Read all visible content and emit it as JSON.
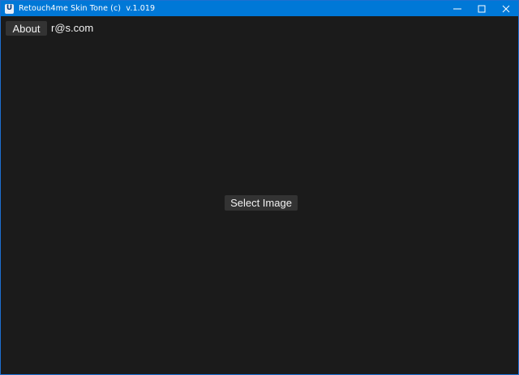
{
  "window": {
    "title": "Retouch4me Skin Tone (c)  v.1.019",
    "icon_glyph": "U",
    "controls": [
      "minimize-icon",
      "maximize-icon",
      "close-icon"
    ]
  },
  "toolbar": {
    "about_label": "About",
    "email": "r@s.com"
  },
  "main": {
    "select_image_label": "Select Image"
  },
  "colors": {
    "titlebar": "#0078d7",
    "background": "#1b1b1b",
    "button": "#333333",
    "text": "#f2f2f2"
  }
}
